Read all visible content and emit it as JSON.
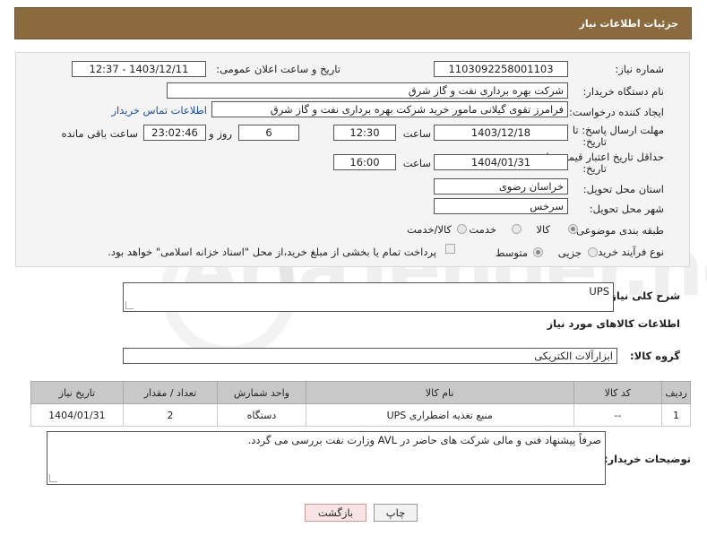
{
  "header": {
    "title": "جزئیات اطلاعات نیاز"
  },
  "labels": {
    "need_number": "شماره نیاز:",
    "announce_datetime": "تاریخ و ساعت اعلان عمومی:",
    "buyer_org": "نام دستگاه خریدار:",
    "requester": "ایجاد کننده درخواست:",
    "deadline": "مهلت ارسال پاسخ: تا",
    "deadline2": "تاریخ:",
    "time": "ساعت",
    "day_and": "روز و",
    "hours_left": "ساعت باقی مانده",
    "price_validity": "حداقل تاریخ اعتبار قیمت: تا",
    "price_validity2": "تاریخ:",
    "time2": "ساعت",
    "province": "استان محل تحویل:",
    "city": "شهر محل تحویل:",
    "category": "طبقه بندی موضوعی:",
    "purchase_type": "نوع فرآیند خرید :",
    "general_desc": "شرح کلی نیاز:",
    "items_info": "اطلاعات کالاهای مورد نیاز",
    "goods_group": "گروه کالا:",
    "buyer_notes": "توضیحات خریدار:"
  },
  "values": {
    "need_number": "1103092258001103",
    "announce_datetime": "1403/12/11 - 12:37",
    "buyer_org": "شرکت بهره برداری نفت و گاز شرق",
    "requester": "فرامرز تقوی گیلانی مامور خرید شرکت بهره برداری نفت و گاز شرق",
    "contact_link": "اطلاعات تماس خریدار",
    "deadline_date": "1403/12/18",
    "deadline_time": "12:30",
    "days": "6",
    "remaining": "23:02:46",
    "validity_date": "1404/01/31",
    "validity_time": "16:00",
    "province": "خراسان رضوی",
    "city": "سرخس",
    "general_desc": "UPS",
    "goods_group": "ابزارآلات الکتریکی",
    "buyer_notes": "صرفاً پیشنهاد فنی و مالی شرکت های حاضر در AVL وزارت نفت بررسی می گردد."
  },
  "category_options": [
    "کالا",
    "خدمت",
    "کالا/خدمت"
  ],
  "category_selected": "کالا",
  "purchase_options": [
    "جزیی",
    "متوسط"
  ],
  "purchase_selected": "متوسط",
  "payment_note": "پرداخت تمام یا بخشی از مبلغ خرید،از محل \"اسناد خزانه اسلامی\" خواهد بود.",
  "table": {
    "headers": [
      "ردیف",
      "کد کالا",
      "نام کالا",
      "واحد شمارش",
      "تعداد / مقدار",
      "تاریخ نیاز"
    ],
    "rows": [
      [
        "1",
        "--",
        "منبع تغذیه اضطراری UPS",
        "دستگاه",
        "2",
        "1404/01/31"
      ]
    ]
  },
  "buttons": {
    "print": "چاپ",
    "back": "بازگشت"
  },
  "watermark": "AriaTender.neT",
  "colors": {
    "header_bg": "#8b6a3e",
    "table_header_bg": "#c8c8c8",
    "link": "#1a4fa6",
    "back_button_bg": "#f8e4e4"
  }
}
